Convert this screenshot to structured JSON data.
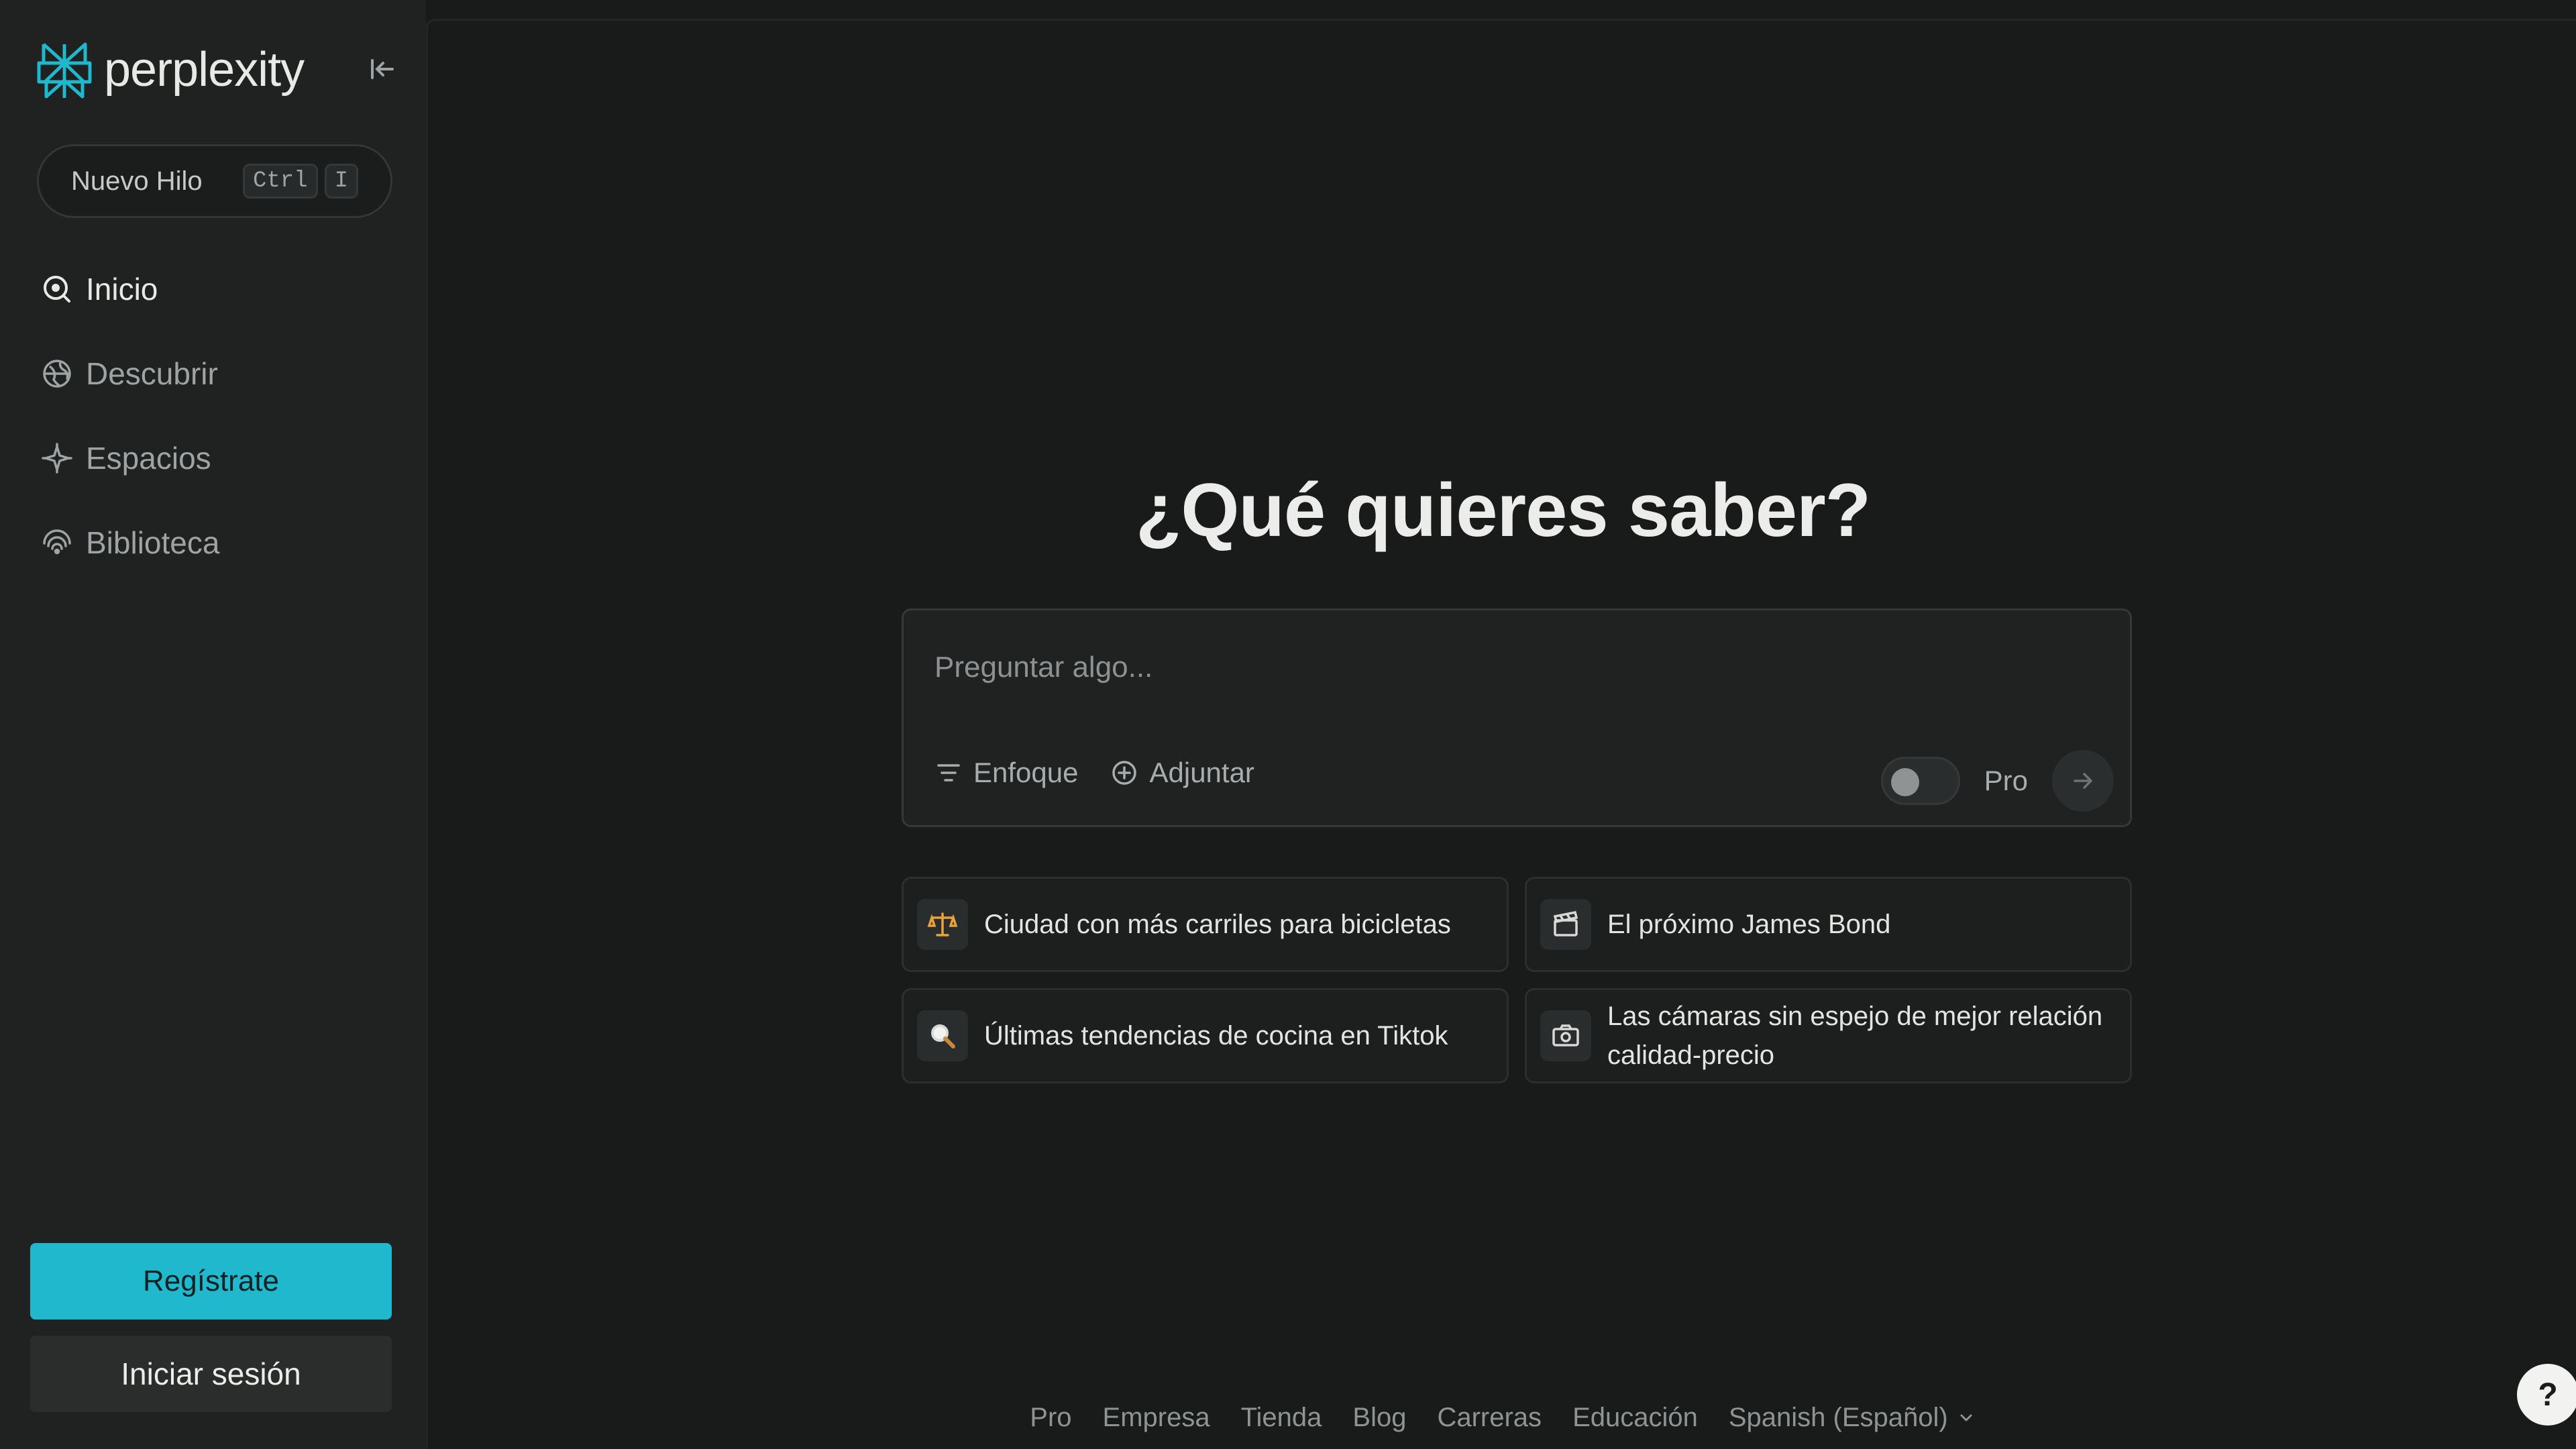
{
  "brand": {
    "name": "perplexity"
  },
  "sidebar": {
    "new_thread_label": "Nuevo Hilo",
    "shortcut_keys": [
      "Ctrl",
      "I"
    ],
    "items": [
      {
        "label": "Inicio",
        "icon": "home-icon",
        "active": true
      },
      {
        "label": "Descubrir",
        "icon": "globe-icon",
        "active": false
      },
      {
        "label": "Espacios",
        "icon": "spaces-icon",
        "active": false
      },
      {
        "label": "Biblioteca",
        "icon": "library-icon",
        "active": false
      }
    ],
    "signup_label": "Regístrate",
    "login_label": "Iniciar sesión"
  },
  "main": {
    "headline": "¿Qué quieres saber?",
    "ask": {
      "placeholder": "Preguntar algo...",
      "focus_label": "Enfoque",
      "attach_label": "Adjuntar",
      "pro_label": "Pro",
      "pro_enabled": false
    },
    "suggestions": [
      {
        "text": "Ciudad con más carriles para bicicletas",
        "icon": "scale-icon"
      },
      {
        "text": "El próximo James Bond",
        "icon": "clapperboard-icon"
      },
      {
        "text": "Últimas tendencias de cocina en Tiktok",
        "icon": "magnifier-icon"
      },
      {
        "text": "Las cámaras sin espejo de mejor relación calidad-precio",
        "icon": "camera-icon"
      }
    ]
  },
  "footer": {
    "links": [
      "Pro",
      "Empresa",
      "Tienda",
      "Blog",
      "Carreras",
      "Educación"
    ],
    "language": "Spanish (Español)"
  },
  "help_label": "?",
  "colors": {
    "accent": "#20b8cd",
    "background": "#191a1a",
    "sidebar": "#202222"
  }
}
